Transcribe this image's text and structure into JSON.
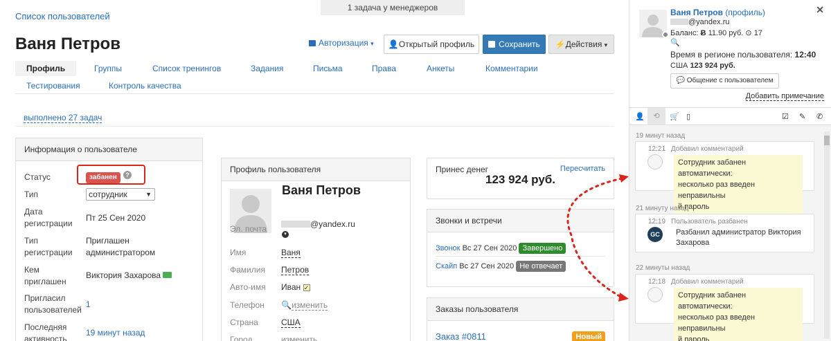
{
  "breadcrumb": "Список пользователей",
  "topbar": "1 задача у менеджеров",
  "page_title": "Ваня Петров",
  "header": {
    "auth": "Авторизация",
    "open_profile": "Открытый профиль",
    "save": "Сохранить",
    "actions": "Действия"
  },
  "tabs": [
    "Профиль",
    "Группы",
    "Список тренингов",
    "Задания",
    "Письма",
    "Права",
    "Анкеты",
    "Комментарии",
    "Тестирования",
    "Контроль качества"
  ],
  "tasks_link": "выполнено 27 задач",
  "info": {
    "title": "Информация о пользователе",
    "status_label": "Статус",
    "status_value": "забанен",
    "type_label": "Тип",
    "type_value": "сотрудник",
    "reg_date_label_1": "Дата",
    "reg_date_label_2": "регистрации",
    "reg_date_value": "Пт 25 Сен 2020",
    "reg_type_label_1": "Тип",
    "reg_type_label_2": "регистрации",
    "reg_type_value_1": "Приглашен",
    "reg_type_value_2": "администратором",
    "invited_by_label_1": "Кем",
    "invited_by_label_2": "приглашен",
    "invited_by_value": "Виктория Захарова",
    "invited_users_label_1": "Пригласил",
    "invited_users_label_2": "пользователей",
    "invited_users_value": "1",
    "last_activity_label_1": "Последняя",
    "last_activity_label_2": "активность",
    "last_activity_value": "19 минут назад"
  },
  "profile": {
    "title": "Профиль пользователя",
    "name": "Ваня Петров",
    "email_label": "Эл. почта",
    "email_value": "@yandex.ru",
    "first_name_label": "Имя",
    "first_name_value": "Ваня",
    "last_name_label": "Фамилия",
    "last_name_value": "Петров",
    "auto_name_label": "Авто-имя",
    "auto_name_value": "Иван",
    "phone_label": "Телефон",
    "phone_value": "изменить",
    "country_label": "Страна",
    "country_value": "США",
    "city_label": "Город",
    "city_value": "изменить"
  },
  "money": {
    "title": "Принес денег",
    "recalc": "Пересчитать",
    "amount": "123 924 руб."
  },
  "calls": {
    "title": "Звонки и встречи",
    "items": [
      {
        "type": "Звонок",
        "date": "Вс 27 Сен 2020",
        "status": "Завершено",
        "color": "#2e8b2e"
      },
      {
        "type": "Скайп",
        "date": "Вс 27 Сен 2020",
        "status": "Не отвечает",
        "color": "#777777"
      }
    ]
  },
  "orders": {
    "title": "Заказы пользователя",
    "order": "Заказ #0811",
    "badge": "Новый"
  },
  "sidebar": {
    "name": "Ваня Петров",
    "profile_link": "(профиль)",
    "email": "@yandex.ru",
    "balance_label": "Баланс:",
    "balance_value": "11.90 руб.",
    "points": "17",
    "time_label": "Время в регионе пользователя:",
    "time_value": "12:40",
    "country": "США",
    "revenue": "123 924 руб.",
    "chat_button": "Общение с пользователем",
    "add_note": "Добавить примечание",
    "feed": [
      {
        "ago": "19 минут назад",
        "time": "12:21",
        "title": "Добавил комментарий",
        "text_1": "Сотрудник забанен автоматически:",
        "text_2": "несколько раз введен неправильны",
        "text_3": "й пароль"
      },
      {
        "ago": "21 минуту назад",
        "time": "12:19",
        "title": "Пользователь разбанен",
        "text_1": "Разбанил администратор Виктория",
        "text_2": "Захарова",
        "avatar": "GC"
      },
      {
        "ago": "22 минуты назад",
        "time": "12:18",
        "title": "Добавил комментарий",
        "text_1": "Сотрудник забанен автоматически:",
        "text_2": "несколько раз введен неправильны",
        "text_3": "й пароль"
      }
    ]
  }
}
